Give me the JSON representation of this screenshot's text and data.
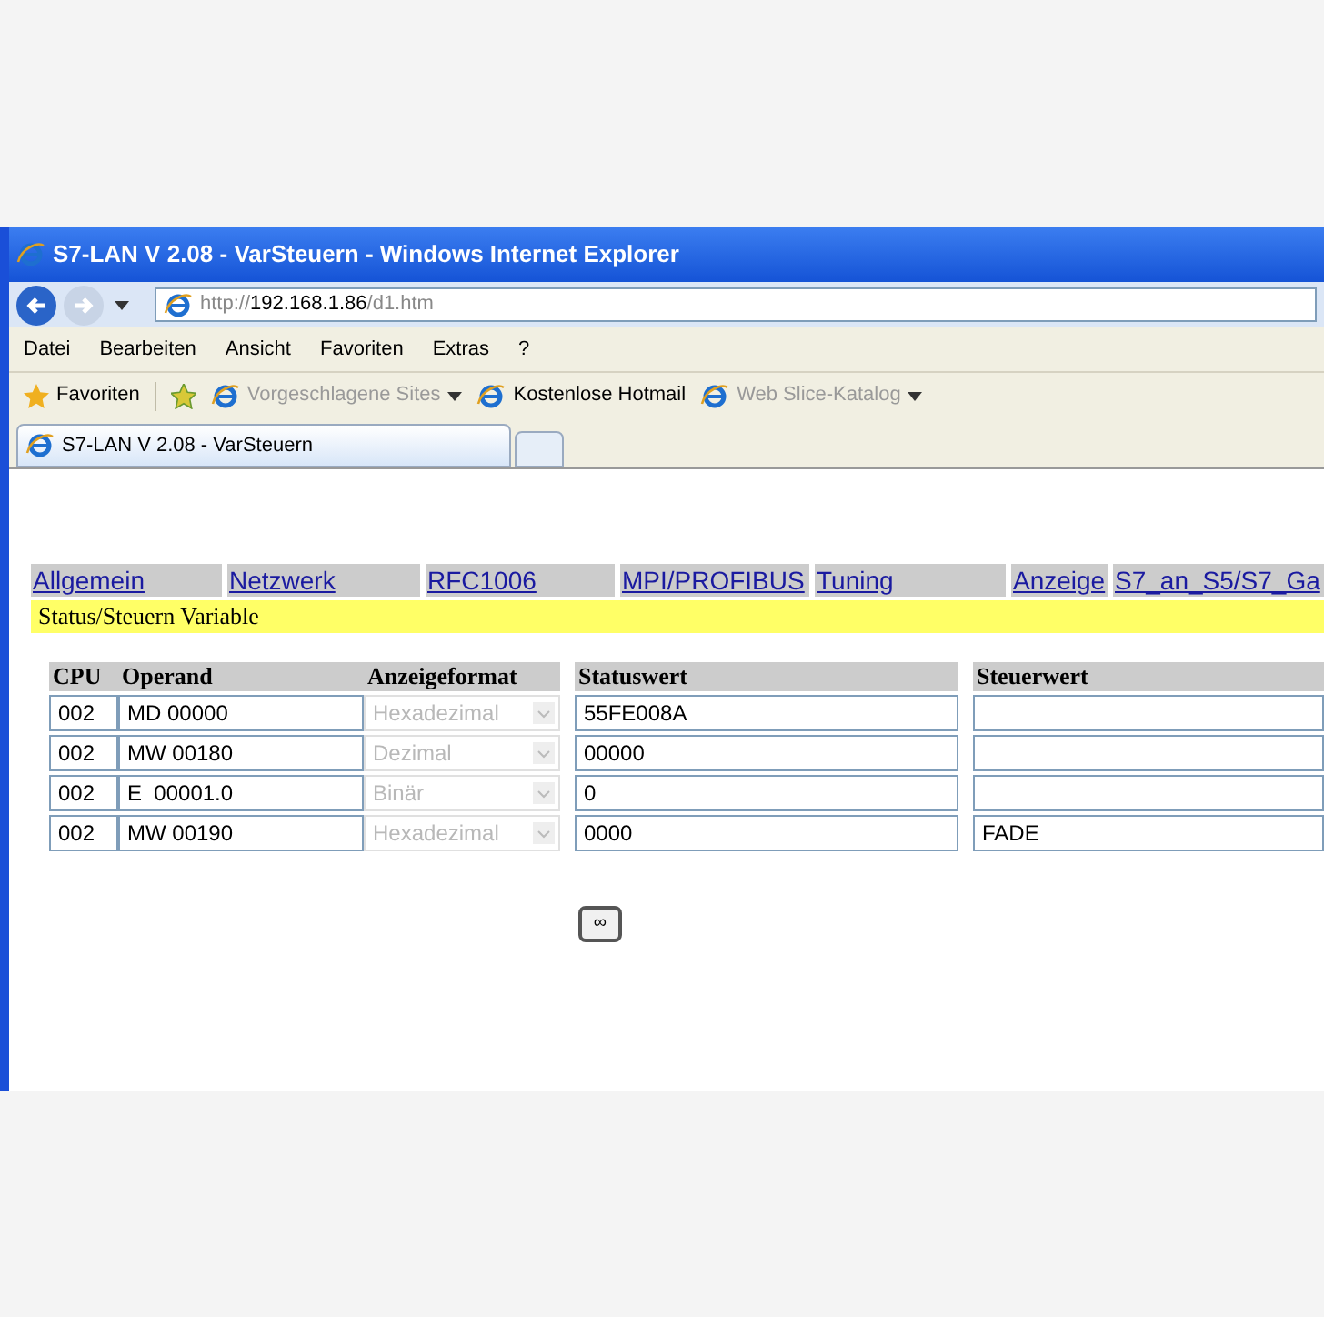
{
  "window": {
    "title": "S7-LAN V 2.08 - VarSteuern - Windows Internet Explorer"
  },
  "address": {
    "prefix": "http://",
    "host": "192.168.1.86",
    "path": "/d1.htm"
  },
  "menu": [
    "Datei",
    "Bearbeiten",
    "Ansicht",
    "Favoriten",
    "Extras",
    "?"
  ],
  "favorites_bar": {
    "label": "Favoriten",
    "items": [
      {
        "label": "Vorgeschlagene Sites",
        "disabled": true,
        "dropdown": true
      },
      {
        "label": "Kostenlose Hotmail",
        "disabled": false,
        "dropdown": false
      },
      {
        "label": "Web Slice-Katalog",
        "disabled": true,
        "dropdown": true
      }
    ]
  },
  "tab": {
    "label": "S7-LAN V 2.08 - VarSteuern"
  },
  "nav": [
    "Allgemein",
    "Netzwerk",
    "RFC1006",
    "MPI/PROFIBUS",
    "Tuning",
    "Anzeige",
    "S7_an_S5/S7_Ga"
  ],
  "section": "Status/Steuern Variable",
  "table": {
    "columns": [
      "CPU",
      "Operand",
      "Anzeigeformat",
      "Statuswert",
      "Steuerwert"
    ],
    "rows": [
      {
        "cpu": "002",
        "operand": "MD 00000",
        "format": "Hexadezimal",
        "status": "55FE008A",
        "control": ""
      },
      {
        "cpu": "002",
        "operand": "MW 00180",
        "format": "Dezimal",
        "status": "00000",
        "control": ""
      },
      {
        "cpu": "002",
        "operand": "E  00001.0",
        "format": "Binär",
        "status": "0",
        "control": ""
      },
      {
        "cpu": "002",
        "operand": "MW 00190",
        "format": "Hexadezimal",
        "status": "0000",
        "control": "FADE"
      }
    ]
  },
  "button": "∞"
}
